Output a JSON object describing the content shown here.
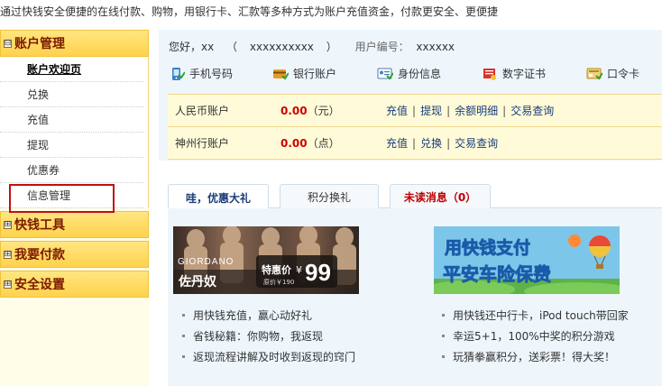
{
  "topbar": {
    "text": "通过快钱安全便捷的在线付款、购物，用银行卡、汇款等多种方式为账户充值资金，付款更安全、更便捷"
  },
  "sidebar": {
    "sections": [
      {
        "box": "⊟",
        "label": "账户管理"
      },
      {
        "box": "⊞",
        "label": "快钱工具"
      },
      {
        "box": "⊞",
        "label": "我要付款"
      },
      {
        "box": "⊞",
        "label": "安全设置"
      }
    ],
    "items": [
      {
        "label": "账户欢迎页"
      },
      {
        "label": "兑换"
      },
      {
        "label": "充值"
      },
      {
        "label": "提现"
      },
      {
        "label": "优惠券"
      },
      {
        "label": "信息管理"
      }
    ]
  },
  "greeting": {
    "hello": "您好，xx",
    "paren_open": "（",
    "account": "xxxxxxxxxx",
    "paren_close": "）",
    "uid_label": "用户编号：",
    "uid_value": "xxxxxx"
  },
  "quick_links": [
    {
      "label": "手机号码",
      "icon": "phone-icon"
    },
    {
      "label": "银行账户",
      "icon": "bank-card-icon"
    },
    {
      "label": "身份信息",
      "icon": "id-card-icon"
    },
    {
      "label": "数字证书",
      "icon": "certificate-icon"
    },
    {
      "label": "口令卡",
      "icon": "token-card-icon"
    }
  ],
  "accounts": [
    {
      "name": "人民币账户",
      "amount": "0.00",
      "unit": "（元）",
      "links": [
        "充值",
        "提现",
        "余额明细",
        "交易查询"
      ]
    },
    {
      "name": "神州行账户",
      "amount": "0.00",
      "unit": "（点）",
      "links": [
        "充值",
        "兑换",
        "交易查询"
      ]
    }
  ],
  "tabs": [
    {
      "label": "哇，优惠大礼"
    },
    {
      "label": "积分换礼"
    },
    {
      "label": "未读消息（0）"
    }
  ],
  "banners": {
    "left": {
      "brand": "GIORDANO",
      "script": "佐丹奴",
      "promo_label": "特惠价",
      "currency": "¥",
      "price": "99",
      "orig": "原价￥190"
    },
    "right": {
      "line1": "用快钱支付",
      "line2": "平安车险保费"
    }
  },
  "promo_left": [
    "用快钱充值，赢心动好礼",
    "省钱秘籍：你购物，我返现",
    "返现流程讲解及时收到返现的窍门"
  ],
  "promo_right": [
    "用快钱还中行卡，iPod touch带回家",
    "幸运5+1，100%中奖的积分游戏",
    "玩猜拳赢积分，送彩票！得大奖！"
  ],
  "colors": {
    "accent_red": "#d00000",
    "link_blue": "#1a3c7a",
    "sidebar_header": "#ffd24d",
    "panel_bg": "#eef6fc"
  }
}
